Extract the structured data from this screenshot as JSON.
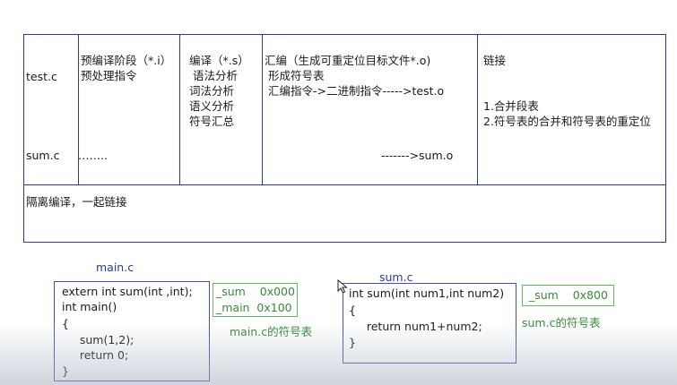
{
  "table": {
    "rows": [
      {
        "file": "test.c",
        "preprocess": "预编译阶段（*.i）\n预处理指令",
        "compile": "编译（*.s）\n 语法分析\n词法分析\n语义分析\n符号汇总",
        "assemble": "汇编（生成可重定位目标文件*.o)\n 形成符号表\n 汇编指令->二进制指令----->test.o",
        "link": "链接\n\n\n1.合并段表\n2.符号表的合并和符号表的重定位"
      },
      {
        "file": "sum.c",
        "preprocess": "……..",
        "compile": "",
        "assemble": "------->sum.o",
        "link": ""
      }
    ],
    "note": "隔离编译，一起链接"
  },
  "main_file": {
    "title": "main.c",
    "code": [
      "extern int sum(int ,int);",
      "int main()",
      "{",
      "     sum(1,2);",
      "     return 0;",
      "}"
    ],
    "symbols": [
      "_sum    0x000",
      "_main  0x100"
    ],
    "symbol_label": "main.c的符号表"
  },
  "sum_file": {
    "title": "sum.c",
    "code": [
      "int sum(int num1,int num2)",
      "{",
      "     return num1+num2;",
      "}"
    ],
    "symbols": [
      "_sum    0x800"
    ],
    "symbol_label": "sum.c的符号表"
  },
  "colors": {
    "border": "#2d3a8c",
    "code_box": "#4a4fa8",
    "symbol_box": "#6bb26b",
    "symbol_text": "#3a8a3a",
    "title": "#2a3a9c"
  }
}
